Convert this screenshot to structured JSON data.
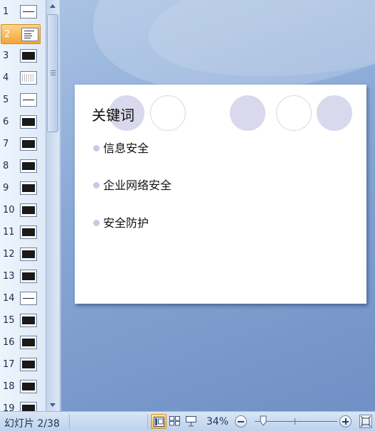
{
  "thumbnails": [
    {
      "number": "1",
      "style": "line"
    },
    {
      "number": "2",
      "style": "list",
      "selected": true
    },
    {
      "number": "3",
      "style": "dark"
    },
    {
      "number": "4",
      "style": "dots"
    },
    {
      "number": "5",
      "style": "line"
    },
    {
      "number": "6",
      "style": "dark"
    },
    {
      "number": "7",
      "style": "dark"
    },
    {
      "number": "8",
      "style": "dark"
    },
    {
      "number": "9",
      "style": "dark"
    },
    {
      "number": "10",
      "style": "dark"
    },
    {
      "number": "11",
      "style": "dark"
    },
    {
      "number": "12",
      "style": "dark"
    },
    {
      "number": "13",
      "style": "dark"
    },
    {
      "number": "14",
      "style": "line"
    },
    {
      "number": "15",
      "style": "dark"
    },
    {
      "number": "16",
      "style": "dark"
    },
    {
      "number": "17",
      "style": "dark"
    },
    {
      "number": "18",
      "style": "dark"
    },
    {
      "number": "19",
      "style": "dark"
    }
  ],
  "slide": {
    "title": "关键词",
    "bullets": [
      "信息安全",
      "企业网络安全",
      "安全防护"
    ]
  },
  "status_bar": {
    "slide_counter": "幻灯片 2/38",
    "zoom_label": "34%",
    "zoom_value": 34,
    "active_view": "normal"
  },
  "colors": {
    "selected_thumb": "#f6a532",
    "circle_fill": "#d9d8ec",
    "bullet": "#c9c8e8",
    "canvas_bg": "#86a6d4"
  },
  "icons": [
    "normal-view-icon",
    "slide-sorter-icon",
    "slideshow-icon",
    "zoom-out-icon",
    "zoom-in-icon",
    "fit-to-window-icon"
  ]
}
